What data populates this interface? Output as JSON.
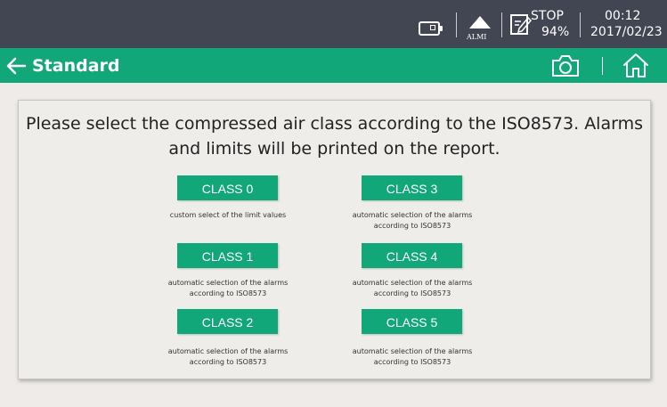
{
  "status_bar": {
    "alarm_label": "ALMI",
    "report_status": "STOP",
    "report_percent": "94%",
    "time": "00:12",
    "date": "2017/02/23",
    "icons": [
      "battery-icon",
      "alarm-triangle-icon",
      "report-edit-icon"
    ]
  },
  "header": {
    "title": "Standard",
    "back_icon": "arrow-left-icon",
    "camera_icon": "camera-icon",
    "home_icon": "home-icon"
  },
  "main": {
    "instruction": "Please select the compressed air class according to the ISO8573. Alarms and limits will be printed on the report.",
    "classes": [
      {
        "label": "CLASS 0",
        "description": "custom select of the limit values"
      },
      {
        "label": "CLASS 1",
        "description": "automatic selection of the alarms according to ISO8573"
      },
      {
        "label": "CLASS 2",
        "description": "automatic selection of the alarms according to ISO8573"
      },
      {
        "label": "CLASS 3",
        "description": "automatic selection of the alarms according to ISO8573"
      },
      {
        "label": "CLASS 4",
        "description": "automatic selection of the alarms according to ISO8573"
      },
      {
        "label": "CLASS 5",
        "description": "automatic selection of the alarms according to ISO8573"
      }
    ]
  },
  "colors": {
    "status_bar": "#414652",
    "accent_green": "#12a779",
    "background": "#eeebe8",
    "text": "#222222"
  }
}
